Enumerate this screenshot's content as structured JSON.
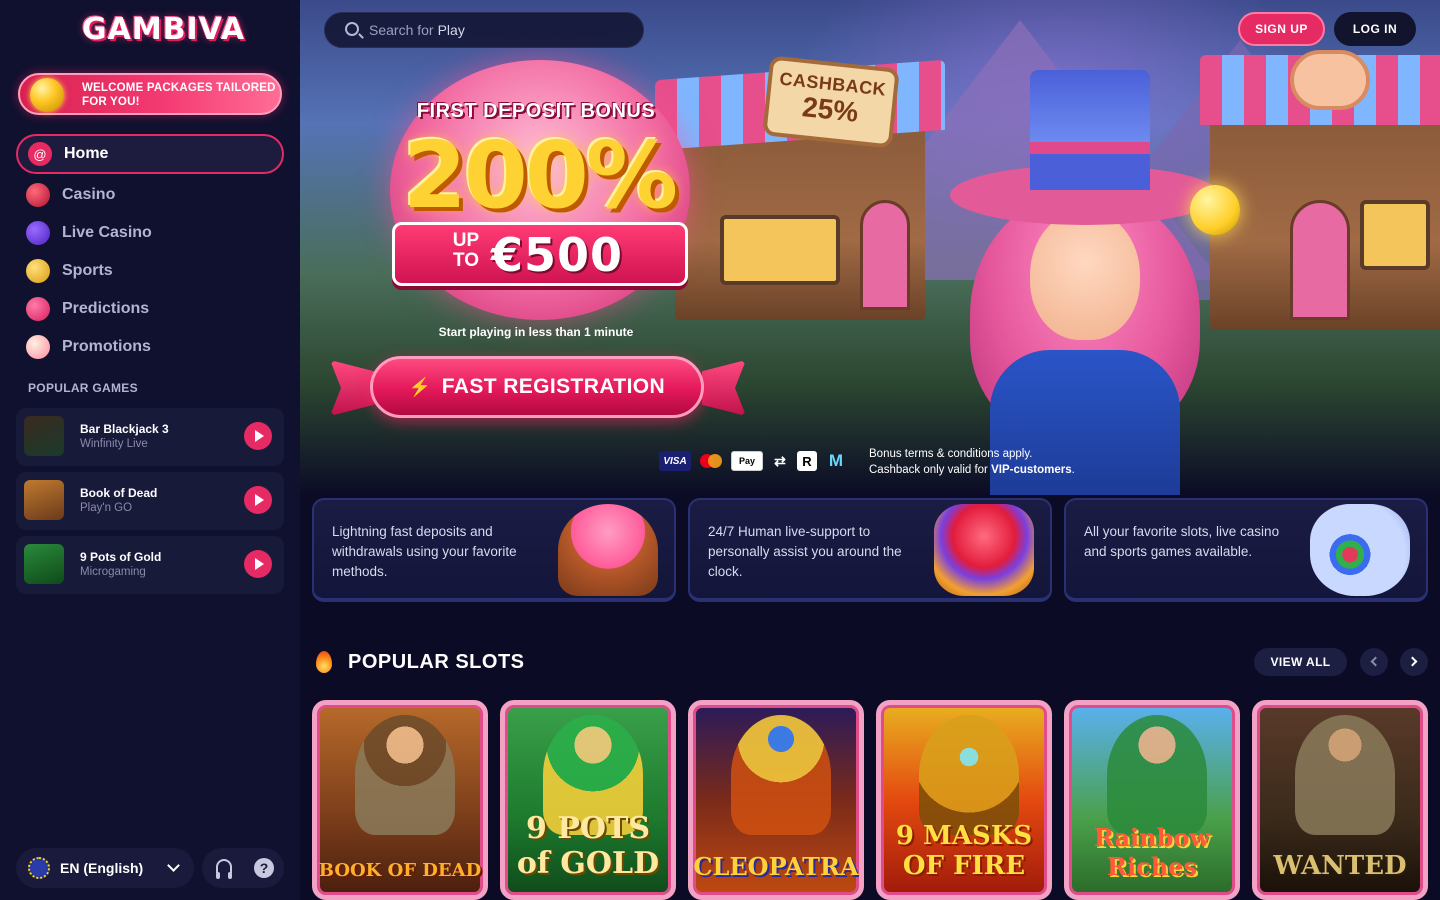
{
  "brand": {
    "logo": "GAMBIVA",
    "accent": "#e62a64"
  },
  "sidebar": {
    "welcome_banner": "WELCOME PACKAGES TAILORED FOR YOU!",
    "nav": [
      {
        "label": "Home",
        "icon": "home-icon"
      },
      {
        "label": "Casino",
        "icon": "casino-icon"
      },
      {
        "label": "Live Casino",
        "icon": "live-casino-icon"
      },
      {
        "label": "Sports",
        "icon": "sports-icon"
      },
      {
        "label": "Predictions",
        "icon": "predictions-icon"
      },
      {
        "label": "Promotions",
        "icon": "promotions-icon"
      }
    ],
    "popular_games_title": "POPULAR GAMES",
    "popular_games": [
      {
        "name": "Bar Blackjack 3",
        "provider": "Winfinity Live"
      },
      {
        "name": "Book of Dead",
        "provider": "Play'n GO"
      },
      {
        "name": "9 Pots of Gold",
        "provider": "Microgaming"
      }
    ],
    "language": "EN (English)"
  },
  "header": {
    "search_prefix": "Search for",
    "search_term": "Play",
    "signup_label": "SIGN UP",
    "login_label": "LOG IN"
  },
  "hero": {
    "cashback_line1": "CASHBACK",
    "cashback_line2": "25%",
    "bonus_title": "FIRST DEPOSIT BONUS",
    "bonus_percent": "200%",
    "up_to_line1": "UP",
    "up_to_line2": "TO",
    "bonus_amount": "€500",
    "start_text": "Start playing in less than 1 minute",
    "register_label": "FAST REGISTRATION",
    "payment_methods": [
      "VISA",
      "Mastercard",
      "Apple Pay",
      "Cashback",
      "Revolut",
      "MiFinity"
    ],
    "terms_line1": "Bonus terms & conditions apply.",
    "terms_line2_prefix": "Cashback only valid for",
    "terms_line2_bold": "VIP-customers",
    "terms_line2_suffix": "."
  },
  "features": [
    {
      "text": "Lightning fast deposits and withdrawals using your favorite methods.",
      "icon": "cake-icon"
    },
    {
      "text": "24/7 Human live-support to personally assist you around the clock.",
      "icon": "clock-icon"
    },
    {
      "text": "All your favorite slots, live casino and sports games available.",
      "icon": "candy-jar-icon"
    }
  ],
  "popular_slots": {
    "title": "POPULAR SLOTS",
    "view_all_label": "VIEW ALL",
    "slots": [
      {
        "title": "BOOK OF DEAD"
      },
      {
        "title": "9 POTS of GOLD"
      },
      {
        "title": "CLEOPATRA"
      },
      {
        "title": "9 MASKS OF FIRE"
      },
      {
        "title": "Rainbow Riches"
      },
      {
        "title": "WANTED"
      }
    ]
  }
}
